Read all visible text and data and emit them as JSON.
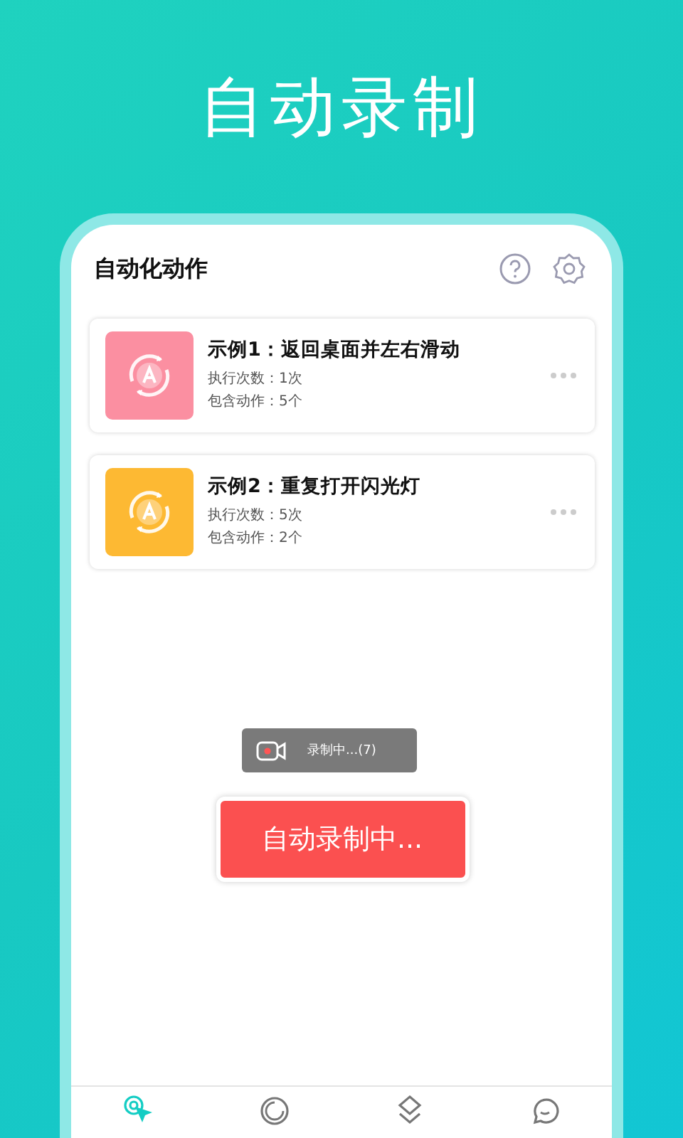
{
  "headline": "自动录制",
  "app": {
    "title": "自动化动作"
  },
  "actions": [
    {
      "title": "示例1：返回桌面并左右滑动",
      "runs": "执行次数：1次",
      "steps": "包含动作：5个",
      "color": "#fb8fa1"
    },
    {
      "title": "示例2：重复打开闪光灯",
      "runs": "执行次数：5次",
      "steps": "包含动作：2个",
      "color": "#fdb933"
    }
  ],
  "recording_toast": {
    "text": "录制中...(7)"
  },
  "record_button": {
    "label": "自动录制中..."
  },
  "nav": [
    {
      "kind": "pointer",
      "selected": true
    },
    {
      "kind": "ring",
      "selected": false
    },
    {
      "kind": "layers",
      "selected": false
    },
    {
      "kind": "chat",
      "selected": false
    }
  ]
}
